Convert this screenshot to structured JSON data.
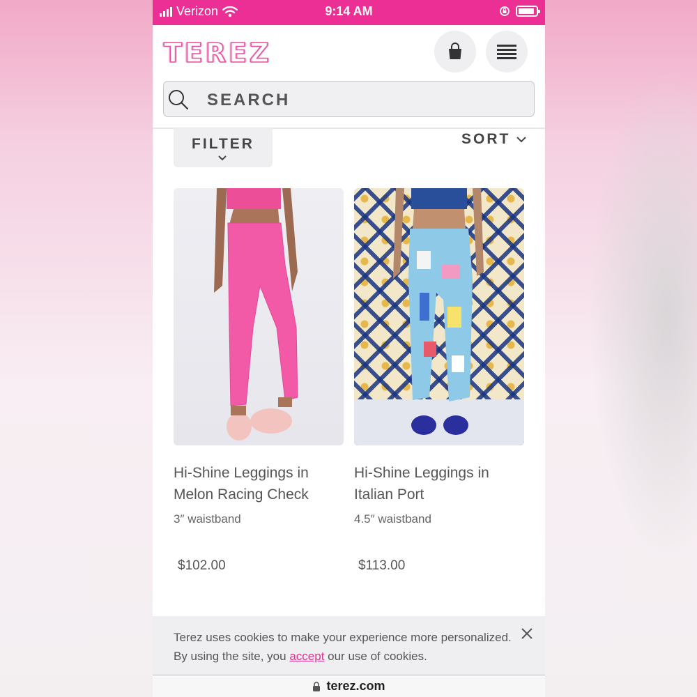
{
  "status_bar": {
    "carrier": "Verizon",
    "time": "9:14 AM",
    "battery_level": 0.9
  },
  "header": {
    "logo": "TEREZ",
    "bag_icon": "shopping-bag-icon",
    "menu_icon": "hamburger-menu-icon",
    "brand_color": "#ec2f94"
  },
  "search": {
    "placeholder": "SEARCH",
    "icon": "search-icon"
  },
  "toolbar": {
    "filter_label": "FILTER",
    "sort_label": "SORT"
  },
  "products": [
    {
      "name_line1": "Hi-Shine Leggings in",
      "name_line2": "Melon Racing Check",
      "subtitle": "3″ waistband",
      "price": "$102.00"
    },
    {
      "name_line1": "Hi-Shine Leggings in",
      "name_line2": "Italian Port",
      "subtitle": "4.5″ waistband",
      "price": "$113.00"
    }
  ],
  "cookie_banner": {
    "text_before": "Terez uses cookies to make your experience more personalized. By using the site, you ",
    "link": "accept",
    "text_after": " our use of cookies.",
    "link_color": "#e0328f"
  },
  "url_bar": {
    "url": "terez.com",
    "icon": "lock-icon"
  }
}
